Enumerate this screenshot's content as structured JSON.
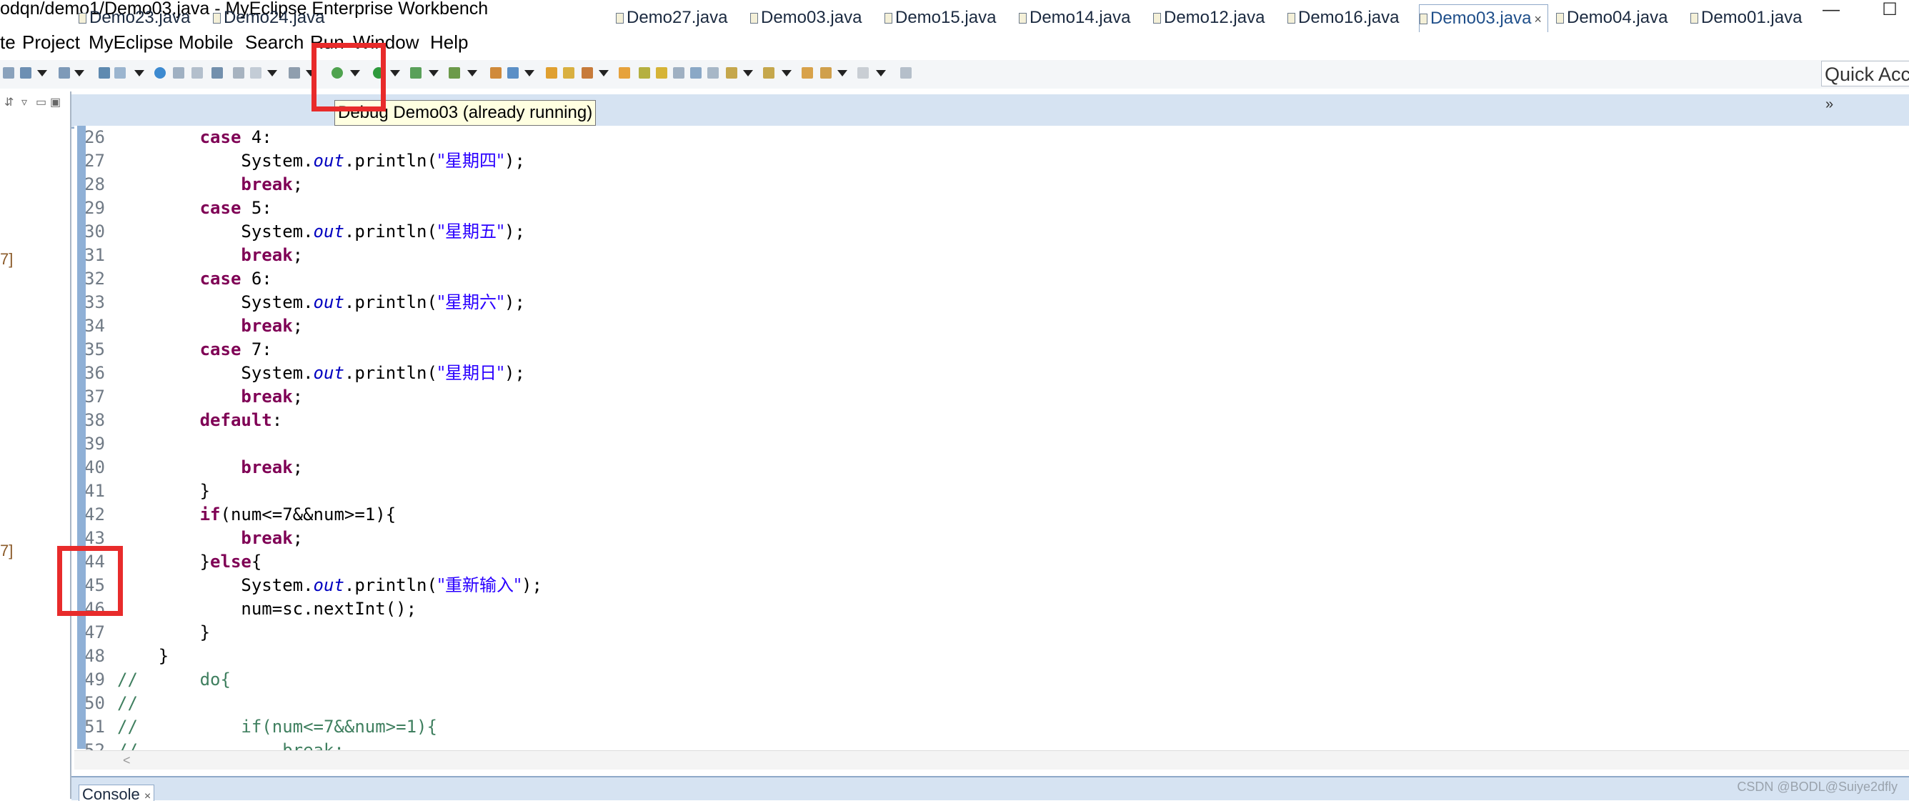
{
  "window": {
    "title": "odqn/demo1/Demo03.java - MyEclipse Enterprise Workbench",
    "minimize": "—",
    "maximize": "☐"
  },
  "menu": [
    "te",
    "Project",
    "MyEclipse",
    "Mobile",
    "Search",
    "Run",
    "Window",
    "Help"
  ],
  "quick_access": {
    "text": "Quick Acce"
  },
  "tooltip": "Debug Demo03 (already running)",
  "tabs": [
    {
      "label": "Demo23.java"
    },
    {
      "label": "Demo24.java"
    },
    {
      "label": "Demo27.java"
    },
    {
      "label": "Demo03.java"
    },
    {
      "label": "Demo15.java"
    },
    {
      "label": "Demo14.java"
    },
    {
      "label": "Demo12.java"
    },
    {
      "label": "Demo16.java"
    },
    {
      "label": "Demo03.java",
      "active": true,
      "close": "×"
    },
    {
      "label": "Demo04.java"
    },
    {
      "label": "Demo01.java"
    }
  ],
  "tabs_overflow": "»",
  "left_panel_fragments": [
    "7]",
    "7]"
  ],
  "code": [
    {
      "n": "26",
      "parts": [
        {
          "t": "        "
        },
        {
          "k": "case"
        },
        {
          "t": " 4:"
        }
      ]
    },
    {
      "n": "27",
      "parts": [
        {
          "t": "            System."
        },
        {
          "f": "out"
        },
        {
          "t": ".println("
        },
        {
          "s": "\"星期四\""
        },
        {
          "t": ");"
        }
      ]
    },
    {
      "n": "28",
      "parts": [
        {
          "t": "            "
        },
        {
          "k": "break"
        },
        {
          "t": ";"
        }
      ]
    },
    {
      "n": "29",
      "parts": [
        {
          "t": "        "
        },
        {
          "k": "case"
        },
        {
          "t": " 5:"
        }
      ]
    },
    {
      "n": "30",
      "parts": [
        {
          "t": "            System."
        },
        {
          "f": "out"
        },
        {
          "t": ".println("
        },
        {
          "s": "\"星期五\""
        },
        {
          "t": ");"
        }
      ]
    },
    {
      "n": "31",
      "parts": [
        {
          "t": "            "
        },
        {
          "k": "break"
        },
        {
          "t": ";"
        }
      ]
    },
    {
      "n": "32",
      "parts": [
        {
          "t": "        "
        },
        {
          "k": "case"
        },
        {
          "t": " 6:"
        }
      ]
    },
    {
      "n": "33",
      "parts": [
        {
          "t": "            System."
        },
        {
          "f": "out"
        },
        {
          "t": ".println("
        },
        {
          "s": "\"星期六\""
        },
        {
          "t": ");"
        }
      ]
    },
    {
      "n": "34",
      "parts": [
        {
          "t": "            "
        },
        {
          "k": "break"
        },
        {
          "t": ";"
        }
      ]
    },
    {
      "n": "35",
      "parts": [
        {
          "t": "        "
        },
        {
          "k": "case"
        },
        {
          "t": " 7:"
        }
      ]
    },
    {
      "n": "36",
      "parts": [
        {
          "t": "            System."
        },
        {
          "f": "out"
        },
        {
          "t": ".println("
        },
        {
          "s": "\"星期日\""
        },
        {
          "t": ");"
        }
      ]
    },
    {
      "n": "37",
      "parts": [
        {
          "t": "            "
        },
        {
          "k": "break"
        },
        {
          "t": ";"
        }
      ]
    },
    {
      "n": "38",
      "parts": [
        {
          "t": "        "
        },
        {
          "k": "default"
        },
        {
          "t": ":"
        }
      ]
    },
    {
      "n": "39",
      "parts": [
        {
          "t": ""
        }
      ]
    },
    {
      "n": "40",
      "parts": [
        {
          "t": "            "
        },
        {
          "k": "break"
        },
        {
          "t": ";"
        }
      ]
    },
    {
      "n": "41",
      "parts": [
        {
          "t": "        }"
        }
      ]
    },
    {
      "n": "42",
      "parts": [
        {
          "t": "        "
        },
        {
          "k": "if"
        },
        {
          "t": "(num<=7&&num>=1){"
        }
      ]
    },
    {
      "n": "43",
      "parts": [
        {
          "t": "            "
        },
        {
          "k": "break"
        },
        {
          "t": ";"
        }
      ]
    },
    {
      "n": "44",
      "parts": [
        {
          "t": "        }"
        },
        {
          "k": "else"
        },
        {
          "t": "{"
        }
      ]
    },
    {
      "n": "45",
      "parts": [
        {
          "t": "            System."
        },
        {
          "f": "out"
        },
        {
          "t": ".println("
        },
        {
          "s": "\"重新输入\""
        },
        {
          "t": ");"
        }
      ]
    },
    {
      "n": "46",
      "parts": [
        {
          "t": "            num=sc.nextInt();"
        }
      ]
    },
    {
      "n": "47",
      "parts": [
        {
          "t": "        }"
        }
      ]
    },
    {
      "n": "48",
      "parts": [
        {
          "t": "    }"
        }
      ]
    },
    {
      "n": "49",
      "parts": [
        {
          "c": "//      do{"
        }
      ]
    },
    {
      "n": "50",
      "parts": [
        {
          "c": "//"
        }
      ]
    },
    {
      "n": "51",
      "parts": [
        {
          "c": "//          if(num<=7&&num>=1){"
        }
      ]
    },
    {
      "n": "52",
      "parts": [
        {
          "c": "//              break;"
        }
      ]
    }
  ],
  "hscroll_left": "<",
  "console": {
    "label": "Console",
    "close": "×"
  },
  "watermark": "CSDN @BODL@Suiye2dfly",
  "colors": {
    "keyword": "#7f0055",
    "field": "#0000c0",
    "string": "#2a00ff",
    "comment": "#3f7f5f",
    "highlight": "#e82b2b"
  }
}
